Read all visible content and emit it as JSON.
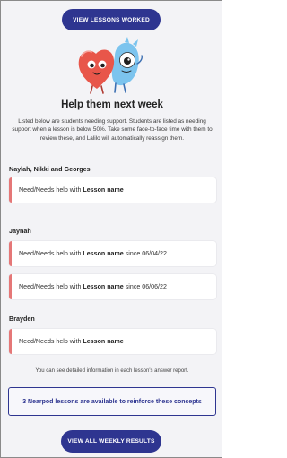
{
  "top_button": "VIEW LESSONS WORKED",
  "heading": "Help them next week",
  "intro": "Listed below are students needing support. Students are listed as needing support when a lesson is below 50%. Take some face-to-face time with them to review these, and Lalilo will automatically reassign them.",
  "groups": [
    {
      "title": "Naylah, Nikki and Georges",
      "rows": [
        {
          "prefix": "Need/Needs help with",
          "lesson": "Lesson name",
          "suffix": ""
        }
      ]
    },
    {
      "title": "Jaynah",
      "rows": [
        {
          "prefix": "Need/Needs help with",
          "lesson": "Lesson name",
          "suffix": "since 06/04/22"
        },
        {
          "prefix": "Need/Needs help with",
          "lesson": "Lesson name",
          "suffix": "since 06/06/22"
        }
      ]
    },
    {
      "title": "Brayden",
      "rows": [
        {
          "prefix": "Need/Needs help with",
          "lesson": "Lesson name",
          "suffix": ""
        }
      ]
    }
  ],
  "note": "You can see detailed information in each lesson's answer report.",
  "nearpod_link": "3 Nearpod lessons are available to reinforce these concepts",
  "bottom_button": "VIEW ALL WEEKLY RESULTS",
  "colors": {
    "primary": "#2e3590",
    "accent_bar": "#e57777",
    "heart": "#e8564a",
    "mascot_blue": "#7cc4ee",
    "background": "#f3f3f6"
  },
  "icons": {
    "mascot": "heart-and-blue-monster-illustration"
  }
}
